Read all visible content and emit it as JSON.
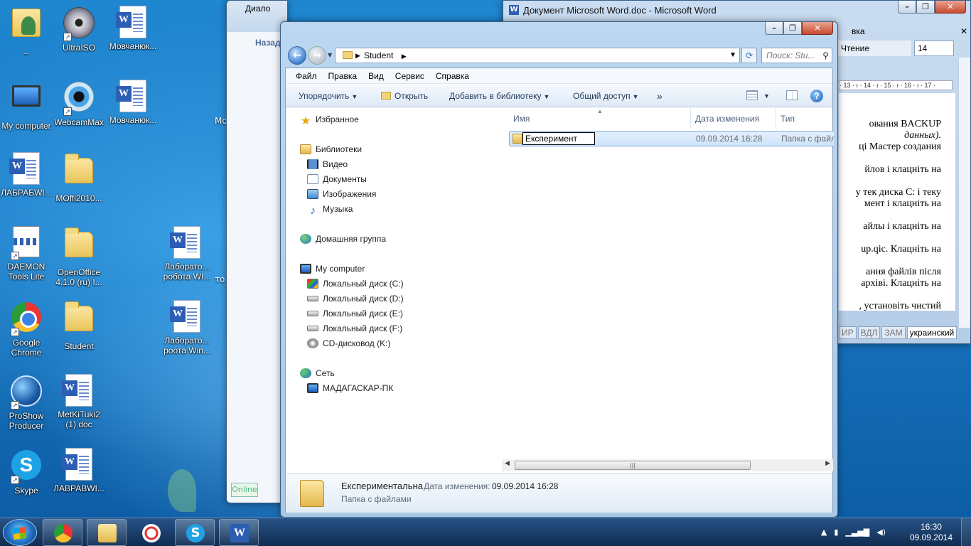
{
  "desktop": {
    "icons": [
      {
        "label": "_"
      },
      {
        "label": "UltraISO"
      },
      {
        "label": "Мовчанюк..."
      },
      {
        "label": "My computer"
      },
      {
        "label": "WebcamMax"
      },
      {
        "label": "Мовчанюк..."
      },
      {
        "label": "ЛАБРАБWI..."
      },
      {
        "label": "MOffi2010..."
      },
      {
        "label": "DAEMON Tools Lite"
      },
      {
        "label": "OpenOffice 4.1.0 (ru) I..."
      },
      {
        "label": "Лаборато... робота WI..."
      },
      {
        "label": "Google Chrome"
      },
      {
        "label": "Student"
      },
      {
        "label": "Лаборато... роота Win..."
      },
      {
        "label": "ProShow Producer"
      },
      {
        "label": "MetKiTuki2 (1).doc"
      },
      {
        "label": "Skype"
      },
      {
        "label": "ЛАВРАВWI..."
      }
    ],
    "partial_labels": [
      "Мо",
      "то"
    ]
  },
  "word_window": {
    "title": "Документ Microsoft Word.doc - Microsoft Word",
    "menu_right": "вка",
    "toolbar": {
      "view": "Чтение",
      "font_size": "14"
    },
    "ruler": "· 13 · ı · 14 · ı · 15 · ı · 16 · ı · 17 ·",
    "text_lines": [
      "ования   BACKUP",
      "данных).",
      "ці Мастер создания",
      "йлов  і  клацніть  на",
      "у тек диска С: і теку",
      "мент  і  клацніть  на",
      "айлы  і  клацніть  на",
      "up.qic.  Клацніть  на",
      "ання  файлів  після",
      "архіві.  Клацніть  на",
      ",  установіть  чистий"
    ],
    "status": [
      "ИР",
      "ВДЛ",
      "ЗАМ",
      "украинский"
    ]
  },
  "dialog_behind": {
    "title": "Диало",
    "nav_label": "Назад",
    "status": "Online"
  },
  "explorer": {
    "address": {
      "folder": "Student"
    },
    "search_placeholder": "Поиск: Stu...",
    "menu": [
      "Файл",
      "Правка",
      "Вид",
      "Сервис",
      "Справка"
    ],
    "commands": {
      "organize": "Упорядочить",
      "open": "Открыть",
      "add_to_library": "Добавить в библиотеку",
      "share": "Общий доступ",
      "more": "»"
    },
    "nav": {
      "favorites": "Избранное",
      "libraries": "Библиотеки",
      "lib_items": [
        "Видео",
        "Документы",
        "Изображения",
        "Музыка"
      ],
      "homegroup": "Домашняя группа",
      "computer": "My computer",
      "drives": [
        "Локальный диск (C:)",
        "Локальный диск (D:)",
        "Локальный диск (E:)",
        "Локальный диск (F:)",
        "CD-дисковод (K:)"
      ],
      "network": "Сеть",
      "network_host": "МАДАГАСКАР-ПК"
    },
    "columns": {
      "name": "Имя",
      "date": "Дата изменения",
      "type": "Тип"
    },
    "file": {
      "name": "Експеримент",
      "date": "09.09.2014 16:28",
      "type": "Папка с файлами"
    },
    "details": {
      "name": "Експериментальна",
      "date_label": "Дата изменения:",
      "date_value": "09.09.2014 16:28",
      "type": "Папка с файлами"
    }
  },
  "taskbar": {
    "clock_time": "16:30",
    "clock_date": "09.09.2014"
  }
}
